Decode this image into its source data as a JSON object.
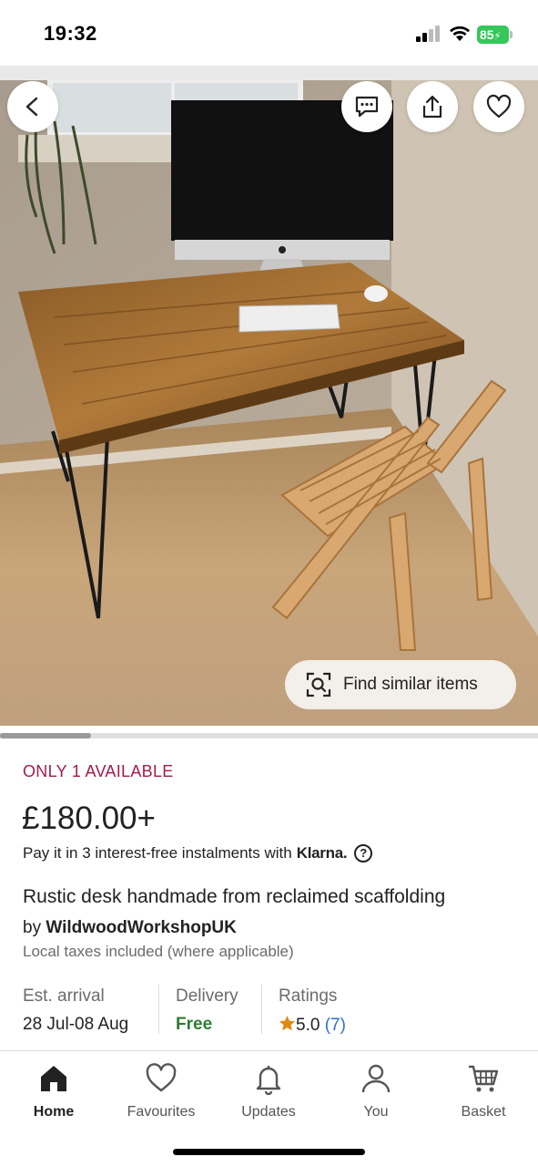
{
  "status_bar": {
    "time": "19:32",
    "battery": "85"
  },
  "hero": {
    "image_description": "wooden-desk-with-imac-and-chair",
    "find_similar_label": "Find similar items",
    "gallery_progress": 0.17
  },
  "icons": {
    "back": "chevron-left-icon",
    "message": "message-icon",
    "share": "share-icon",
    "favourite": "heart-icon",
    "lens": "visual-search-icon"
  },
  "product": {
    "stock_text": "ONLY 1 AVAILABLE",
    "price": "£180.00+",
    "klarna_text": "Pay it in 3 interest-free instalments with",
    "klarna_brand": "Klarna.",
    "title": "Rustic desk handmade from reclaimed scaffolding",
    "seller_prefix": "by",
    "seller_name": "WildwoodWorkshopUK",
    "taxes_note": "Local taxes included (where applicable)"
  },
  "info": {
    "arrival_label": "Est. arrival",
    "arrival_value": "28 Jul-08 Aug",
    "delivery_label": "Delivery",
    "delivery_value": "Free",
    "ratings_label": "Ratings",
    "rating_value": "5.0",
    "rating_count": "(7)"
  },
  "colors": {
    "stock_accent": "#a61a4b",
    "free_green": "#2e7d32",
    "rating_star": "#e0880f",
    "link_blue": "#2f6fd1"
  },
  "tabs": [
    {
      "label": "Home",
      "icon": "home-icon",
      "active": true
    },
    {
      "label": "Favourites",
      "icon": "heart-icon",
      "active": false
    },
    {
      "label": "Updates",
      "icon": "bell-icon",
      "active": false
    },
    {
      "label": "You",
      "icon": "person-icon",
      "active": false
    },
    {
      "label": "Basket",
      "icon": "basket-icon",
      "active": false
    }
  ]
}
